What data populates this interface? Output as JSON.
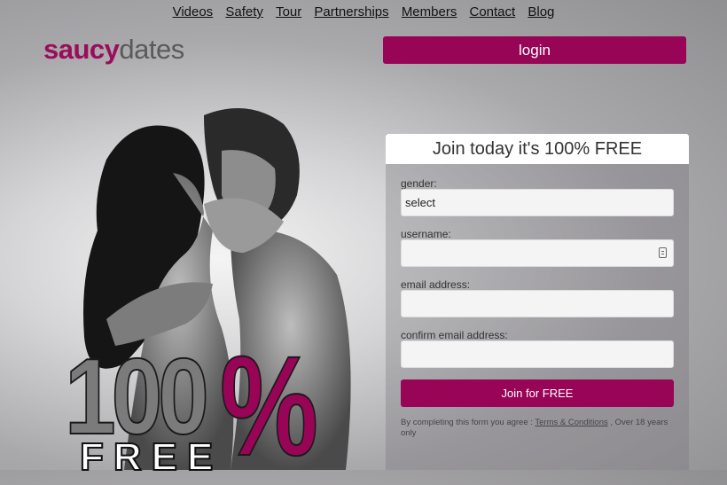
{
  "nav": {
    "items": [
      "Videos",
      "Safety",
      "Tour",
      "Partnerships",
      "Members",
      "Contact",
      "Blog"
    ]
  },
  "logo": {
    "part1": "saucy",
    "part2": "dates"
  },
  "header": {
    "login_label": "login"
  },
  "hero": {
    "big_number": "100",
    "percent": "%",
    "free_text": "FREE"
  },
  "form": {
    "title": "Join today it's 100% FREE",
    "gender_label": "gender:",
    "gender_value": "select",
    "username_label": "username:",
    "email_label": "email address:",
    "confirm_email_label": "confirm email address:",
    "submit_label": "Join for FREE",
    "terms_prefix": "By completing this form you agree :",
    "terms_link": "Terms & Conditions",
    "terms_suffix": ", Over 18 years only"
  },
  "colors": {
    "brand": "#980456",
    "logo_accent": "#9b0c5a"
  }
}
